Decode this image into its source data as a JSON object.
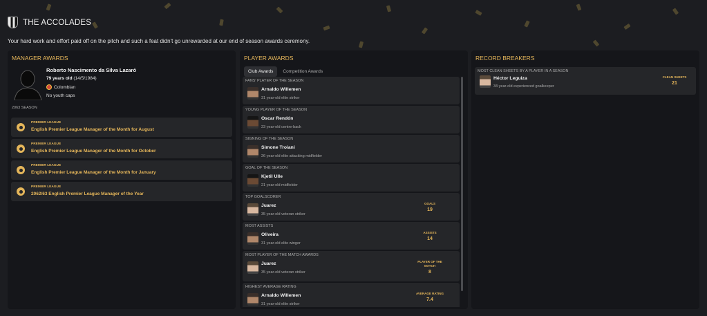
{
  "header": {
    "title": "THE ACCOLADES",
    "subtitle": "Your hard work and effort paid off on the pitch and such a feat didn't go unrewarded at our end of season awards ceremony."
  },
  "manager": {
    "panel_title": "MANAGER AWARDS",
    "name": "Roberto Nascimento da Silva Lazaró",
    "age": "79 years old",
    "dob": "(14/5/1984)",
    "nationality": "Colombian",
    "caps": "No youth caps",
    "season": "2063 SEASON",
    "awards": [
      {
        "competition": "PREMIER LEAGUE",
        "name": "English Premier League Manager of the Month for August"
      },
      {
        "competition": "PREMIER LEAGUE",
        "name": "English Premier League Manager of the Month for October"
      },
      {
        "competition": "PREMIER LEAGUE",
        "name": "English Premier League Manager of the Month for January"
      },
      {
        "competition": "PREMIER LEAGUE",
        "name": "2062/63 English Premier League Manager of the Year"
      }
    ]
  },
  "player_awards": {
    "panel_title": "PLAYER AWARDS",
    "tabs": [
      "Club Awards",
      "Competition Awards"
    ],
    "items": [
      {
        "category": "FANS' PLAYER OF THE SEASON",
        "player": "Arnaldo Willemen",
        "desc": "31 year-old elite striker",
        "stat_label": "",
        "stat_value": ""
      },
      {
        "category": "YOUNG PLAYER OF THE SEASON",
        "player": "Oscar Rendón",
        "desc": "23 year-old centre-back",
        "stat_label": "",
        "stat_value": ""
      },
      {
        "category": "SIGNING OF THE SEASON",
        "player": "Simone Troiani",
        "desc": "26 year-old elite attacking midfielder",
        "stat_label": "",
        "stat_value": ""
      },
      {
        "category": "GOAL OF THE SEASON",
        "player": "Kjetil Ulle",
        "desc": "21 year-old midfielder",
        "stat_label": "",
        "stat_value": ""
      },
      {
        "category": "TOP GOALSCORER",
        "player": "Juarez",
        "desc": "35 year-old veteran striker",
        "stat_label": "GOALS",
        "stat_value": "19"
      },
      {
        "category": "MOST ASSISTS",
        "player": "Oliveira",
        "desc": "31 year-old elite winger",
        "stat_label": "ASSISTS",
        "stat_value": "14"
      },
      {
        "category": "MOST PLAYER OF THE MATCH AWARDS",
        "player": "Juarez",
        "desc": "35 year-old veteran striker",
        "stat_label": "PLAYER OF THE MATCH",
        "stat_value": "8"
      },
      {
        "category": "HIGHEST AVERAGE RATING",
        "player": "Arnaldo Willemen",
        "desc": "31 year-old elite striker",
        "stat_label": "AVERAGE RATING",
        "stat_value": "7.4"
      }
    ]
  },
  "records": {
    "panel_title": "RECORD BREAKERS",
    "items": [
      {
        "category": "MOST CLEAN SHEETS BY A PLAYER IN A SEASON",
        "player": "Héctor Leguiza",
        "desc": "34 year-old experienced goalkeeper",
        "stat_label": "CLEAN SHEETS",
        "stat_value": "21"
      }
    ]
  }
}
